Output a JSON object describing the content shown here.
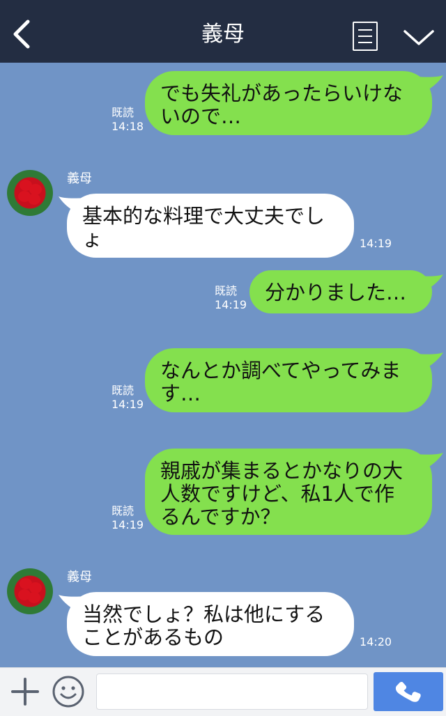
{
  "header": {
    "title": "義母"
  },
  "messages": [
    {
      "side": "right",
      "text": "でも失礼があったらいけないので…",
      "read": "既読",
      "time": "14:18"
    },
    {
      "side": "left",
      "sender": "義母",
      "text": "基本的な料理で大丈夫でしょ",
      "time": "14:19"
    },
    {
      "side": "right",
      "text": "分かりました…",
      "read": "既読",
      "time": "14:19"
    },
    {
      "side": "right",
      "text": "なんとか調べてやってみます…",
      "read": "既読",
      "time": "14:19"
    },
    {
      "side": "right",
      "text": "親戚が集まるとかなりの大人数ですけど、私1人で作るんですか？",
      "read": "既読",
      "time": "14:19"
    },
    {
      "side": "left",
      "sender": "義母",
      "text": "当然でしょ？私は他にすることがあるもの",
      "time": "14:20"
    }
  ],
  "lines": {
    "m0": [
      "でも失礼があったらいけな",
      "いので…"
    ],
    "m1": [
      "基本的な料理で大丈夫でし",
      "ょ"
    ],
    "m2": [
      "分かりました…"
    ],
    "m3": [
      "なんとか調べてやってみま",
      "す…"
    ],
    "m4": [
      "親戚が集まるとかなりの大",
      "人数ですけど、私1人で作",
      "るんですか？"
    ],
    "m5": [
      "当然でしょ？私は他にする",
      "ことがあるもの"
    ]
  },
  "footer": {
    "input_placeholder": ""
  },
  "colors": {
    "background": "#7094c6",
    "header": "#232d42",
    "bubble_mine": "#84e04e",
    "bubble_theirs": "#ffffff",
    "call_button": "#4f86e3"
  },
  "icons": [
    "back-chevron-icon",
    "menu-list-icon",
    "chevron-down-icon",
    "plus-icon",
    "emoji-icon",
    "phone-icon"
  ]
}
